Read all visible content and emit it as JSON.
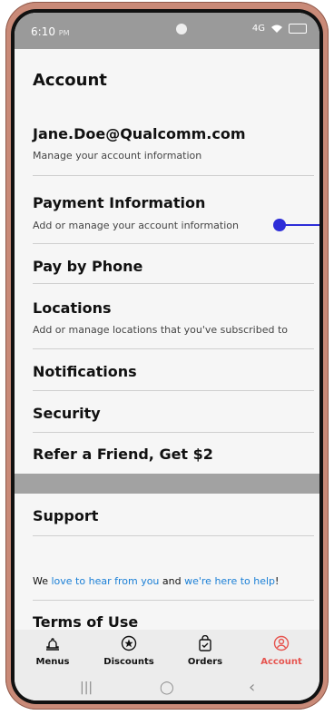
{
  "status": {
    "time": "6:10",
    "ampm": "PM",
    "network": "4G"
  },
  "page": {
    "title": "Account"
  },
  "items": [
    {
      "title": "Jane.Doe@Qualcomm.com",
      "subtitle": "Manage your account information"
    },
    {
      "title": "Payment Information",
      "subtitle": "Add or manage your account information"
    },
    {
      "title": "Pay by Phone"
    },
    {
      "title": "Locations",
      "subtitle": "Add or manage locations that you've subscribed to"
    },
    {
      "title": "Notifications"
    },
    {
      "title": "Security"
    },
    {
      "title": "Refer a Friend, Get $2"
    }
  ],
  "support": {
    "title": "Support"
  },
  "help": {
    "prefix": "We ",
    "link1": "love to hear from you",
    "mid": " and ",
    "link2": "we're here to help",
    "suffix": "!"
  },
  "terms": {
    "title": "Terms of Use"
  },
  "nav": [
    {
      "label": "Menus",
      "icon": "bell-icon"
    },
    {
      "label": "Discounts",
      "icon": "star-circle-icon"
    },
    {
      "label": "Orders",
      "icon": "bag-check-icon"
    },
    {
      "label": "Account",
      "icon": "user-circle-icon",
      "active": true
    }
  ],
  "sys": {
    "recent": "|||",
    "home": "◯",
    "back": "‹"
  },
  "colors": {
    "accent": "#e6544f",
    "link": "#1a7fd6",
    "annotation": "#2d2dd8"
  }
}
